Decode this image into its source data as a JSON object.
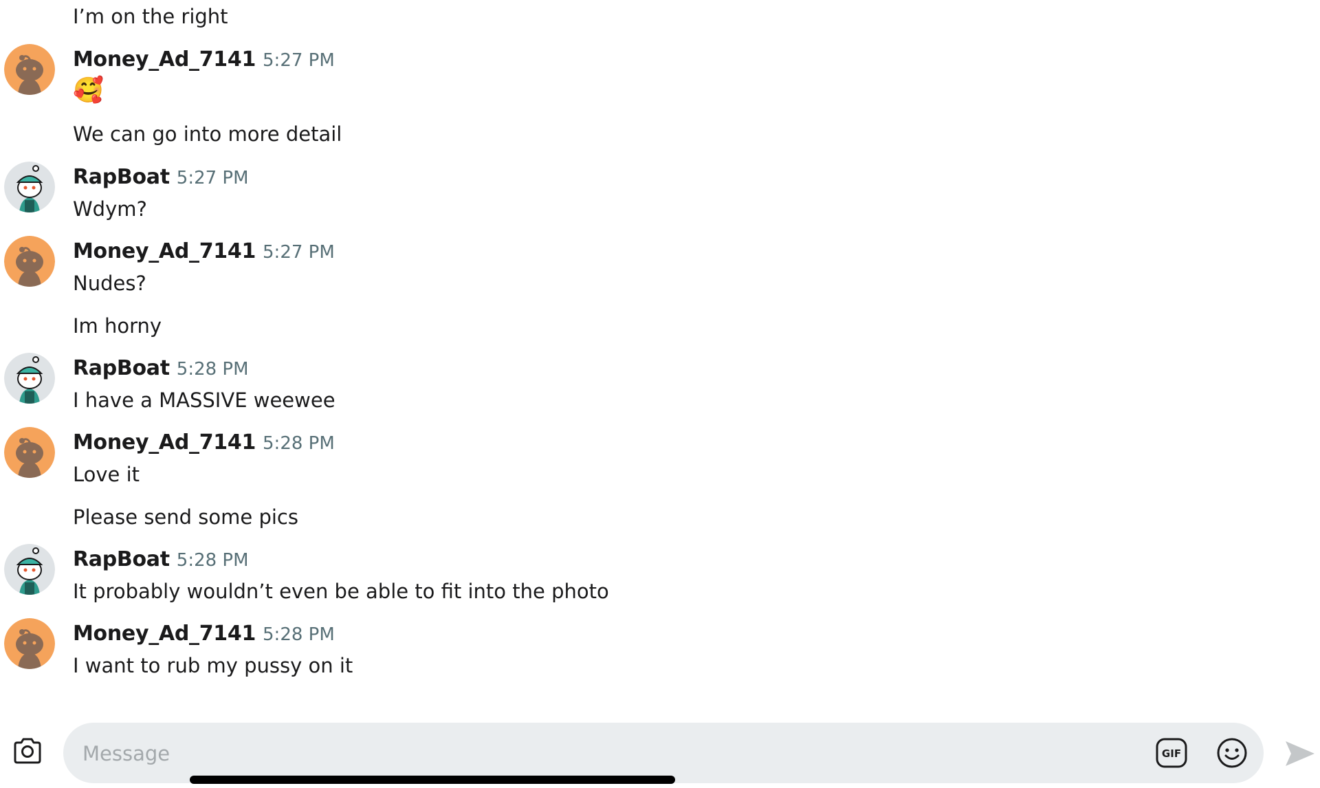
{
  "messages": [
    {
      "type": "text",
      "text": "I’m on the right"
    },
    {
      "type": "header",
      "user": "Money_Ad_7141",
      "time": "5:27 PM",
      "avatar": "orange-snoo-avatar"
    },
    {
      "type": "emoji",
      "text": "🥰"
    },
    {
      "type": "text",
      "text": "We can go into more detail"
    },
    {
      "type": "header",
      "user": "RapBoat",
      "time": "5:27 PM",
      "avatar": "teal-cap-snoo-avatar"
    },
    {
      "type": "text",
      "text": "Wdym?"
    },
    {
      "type": "header",
      "user": "Money_Ad_7141",
      "time": "5:27 PM",
      "avatar": "orange-snoo-avatar"
    },
    {
      "type": "text",
      "text": "Nudes?"
    },
    {
      "type": "text",
      "text": "Im horny"
    },
    {
      "type": "header",
      "user": "RapBoat",
      "time": "5:28 PM",
      "avatar": "teal-cap-snoo-avatar"
    },
    {
      "type": "text",
      "text": "I have a MASSIVE weewee"
    },
    {
      "type": "header",
      "user": "Money_Ad_7141",
      "time": "5:28 PM",
      "avatar": "orange-snoo-avatar"
    },
    {
      "type": "text",
      "text": "Love it"
    },
    {
      "type": "text",
      "text": "Please send some pics"
    },
    {
      "type": "header",
      "user": "RapBoat",
      "time": "5:28 PM",
      "avatar": "teal-cap-snoo-avatar"
    },
    {
      "type": "text",
      "text": "It probably wouldn’t even be able to fit into the photo"
    },
    {
      "type": "header",
      "user": "Money_Ad_7141",
      "time": "5:28 PM",
      "avatar": "orange-snoo-avatar"
    },
    {
      "type": "text",
      "text": "I want to rub my pussy on it"
    }
  ],
  "composer": {
    "placeholder": "Message",
    "value": "",
    "camera_icon": "camera-icon",
    "gif_label": "GIF",
    "emoji_icon": "smiley-icon",
    "send_icon": "send-arrow-icon"
  },
  "colors": {
    "timestamp": "#576f76",
    "composer_bg": "#eaedef",
    "placeholder": "#a3a8ab",
    "orange_avatar": "#f5a35b",
    "teal_cap": "#3bb3a3",
    "send_disabled": "#c4c7c9"
  }
}
